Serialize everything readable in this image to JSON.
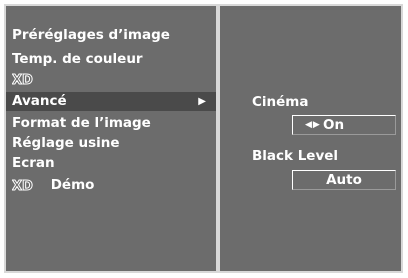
{
  "menu": {
    "items": [
      {
        "label": "Préréglages d’image"
      },
      {
        "label": "Temp. de couleur"
      },
      {
        "label": "",
        "logo": "xd-logo"
      },
      {
        "label": "Avancé",
        "selected": true,
        "arrow": "▶"
      },
      {
        "label": "Format de l’image"
      },
      {
        "label": "Réglage usine"
      },
      {
        "label": "Ecran"
      },
      {
        "label": "Démo",
        "logo": "xd-logo"
      }
    ]
  },
  "submenu": {
    "cinema": {
      "label": "Cinéma",
      "arrows": "◀▶",
      "value": "On"
    },
    "black_level": {
      "label": "Black Level",
      "value": "Auto"
    }
  },
  "colors": {
    "panel": "#6c6c6c",
    "border": "#d8d8d8",
    "selected": "#4a4a4a",
    "text": "#ffffff"
  }
}
